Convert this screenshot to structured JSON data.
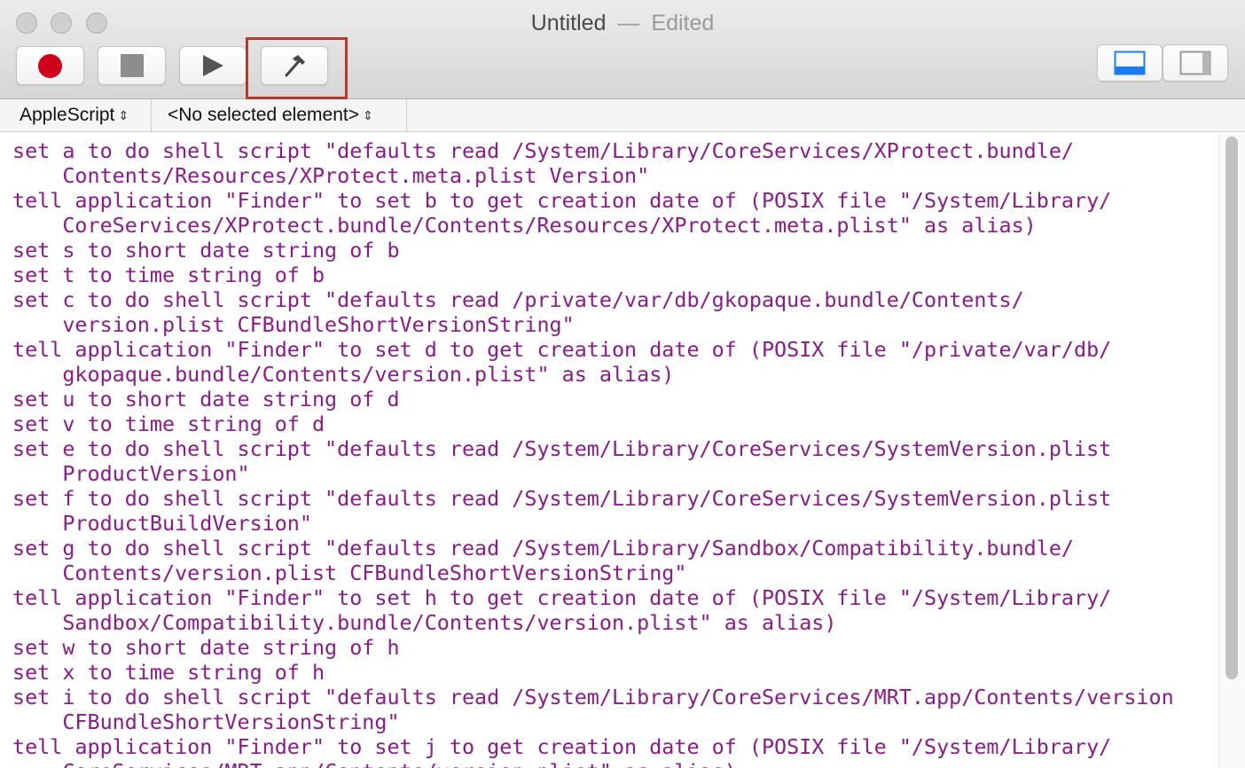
{
  "window": {
    "title": "Untitled",
    "separator": "—",
    "status": "Edited"
  },
  "toolbar": {
    "buttons": [
      {
        "name": "record",
        "icon": "record-icon"
      },
      {
        "name": "stop",
        "icon": "stop-icon"
      },
      {
        "name": "run",
        "icon": "play-icon"
      },
      {
        "name": "compile",
        "icon": "hammer-icon",
        "highlighted": true
      }
    ],
    "view_buttons": [
      {
        "name": "show-log",
        "icon": "bottom-pane-icon",
        "active": true
      },
      {
        "name": "show-inspector",
        "icon": "side-pane-icon",
        "active": false
      }
    ]
  },
  "navigation": {
    "language": "AppleScript",
    "element": "<No selected element>"
  },
  "editor": {
    "lines": [
      "set a to do shell script \"defaults read /System/Library/CoreServices/XProtect.bundle/",
      "    Contents/Resources/XProtect.meta.plist Version\"",
      "tell application \"Finder\" to set b to get creation date of (POSIX file \"/System/Library/",
      "    CoreServices/XProtect.bundle/Contents/Resources/XProtect.meta.plist\" as alias)",
      "set s to short date string of b",
      "set t to time string of b",
      "set c to do shell script \"defaults read /private/var/db/gkopaque.bundle/Contents/",
      "    version.plist CFBundleShortVersionString\"",
      "tell application \"Finder\" to set d to get creation date of (POSIX file \"/private/var/db/",
      "    gkopaque.bundle/Contents/version.plist\" as alias)",
      "set u to short date string of d",
      "set v to time string of d",
      "set e to do shell script \"defaults read /System/Library/CoreServices/SystemVersion.plist",
      "    ProductVersion\"",
      "set f to do shell script \"defaults read /System/Library/CoreServices/SystemVersion.plist",
      "    ProductBuildVersion\"",
      "set g to do shell script \"defaults read /System/Library/Sandbox/Compatibility.bundle/",
      "    Contents/version.plist CFBundleShortVersionString\"",
      "tell application \"Finder\" to set h to get creation date of (POSIX file \"/System/Library/",
      "    Sandbox/Compatibility.bundle/Contents/version.plist\" as alias)",
      "set w to short date string of h",
      "set x to time string of h",
      "set i to do shell script \"defaults read /System/Library/CoreServices/MRT.app/Contents/version",
      "    CFBundleShortVersionString\"",
      "tell application \"Finder\" to set j to get creation date of (POSIX file \"/System/Library/",
      "    CoreServices/MRT.app/Contents/version.plist\" as alias)"
    ]
  },
  "colors": {
    "code_text": "#8b1a8b",
    "record_red": "#d0021b",
    "highlight_box": "#b53a2a",
    "active_view_blue": "#1a7ef2"
  }
}
